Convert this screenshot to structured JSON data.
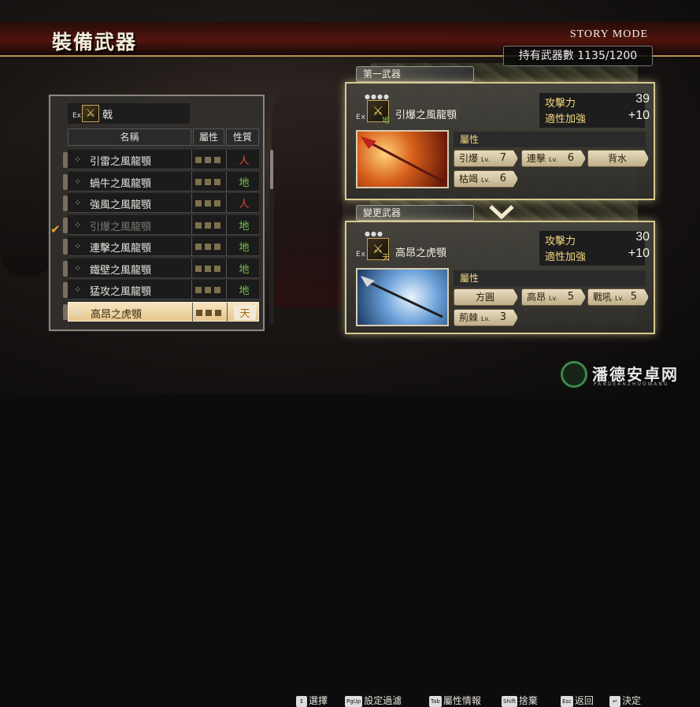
{
  "header": {
    "title": "裝備武器",
    "mode": "STORY MODE",
    "owned": "持有武器數 1135/1200"
  },
  "list": {
    "ex": "Ex",
    "type_name": "戟",
    "col_name": "名稱",
    "col_attr": "屬性",
    "col_nature": "性質",
    "rows": [
      {
        "name": "引雷之風龍顎",
        "nature": "人",
        "nature_color": "#d84a3a"
      },
      {
        "name": "蝸牛之風龍顎",
        "nature": "地",
        "nature_color": "#7ac050"
      },
      {
        "name": "強風之風龍顎",
        "nature": "人",
        "nature_color": "#d84a3a"
      },
      {
        "name": "引爆之風龍顎",
        "nature": "地",
        "nature_color": "#7ac050"
      },
      {
        "name": "連擊之風龍顎",
        "nature": "地",
        "nature_color": "#7ac050"
      },
      {
        "name": "鐵壁之風龍顎",
        "nature": "地",
        "nature_color": "#7ac050"
      },
      {
        "name": "猛攻之風龍顎",
        "nature": "地",
        "nature_color": "#7ac050"
      },
      {
        "name": "高昂之虎顎",
        "nature": "天",
        "nature_color": "#a66410"
      }
    ]
  },
  "current": {
    "label": "第一武器",
    "ex": "Ex",
    "nature": "地",
    "name": "引爆之風龍顎",
    "atk_label": "攻擊力",
    "atk": "39",
    "bonus_label": "適性加強",
    "bonus": "+10",
    "attr_label": "屬性",
    "tags": [
      {
        "name": "引爆",
        "lv": "Lv.",
        "n": "7"
      },
      {
        "name": "連擊",
        "lv": "Lv.",
        "n": "6"
      },
      {
        "name": "背水",
        "lv": "",
        "n": ""
      },
      {
        "name": "枯竭",
        "lv": "Lv.",
        "n": "6"
      }
    ]
  },
  "change": {
    "label": "變更武器",
    "ex": "Ex",
    "nature": "天",
    "name": "高昂之虎顎",
    "atk_label": "攻擊力",
    "atk": "30",
    "bonus_label": "適性加強",
    "bonus": "+10",
    "attr_label": "屬性",
    "tags": [
      {
        "name": "方圓",
        "lv": "",
        "n": ""
      },
      {
        "name": "高昂",
        "lv": "Lv.",
        "n": "5"
      },
      {
        "name": "戰吼",
        "lv": "Lv.",
        "n": "5"
      },
      {
        "name": "荊棘",
        "lv": "Lv.",
        "n": "3"
      }
    ]
  },
  "footer": [
    {
      "key": "↕",
      "label": "選擇"
    },
    {
      "key": "PgUp",
      "label": "設定過濾"
    },
    {
      "key": "Tab",
      "label": "屬性情報"
    },
    {
      "key": "Shift",
      "label": "捨棄"
    },
    {
      "key": "Esc",
      "label": "返回"
    },
    {
      "key": "↵",
      "label": "決定"
    }
  ],
  "watermark": {
    "text": "潘德安卓网",
    "sub": "PANDEANZHUOWANG"
  }
}
